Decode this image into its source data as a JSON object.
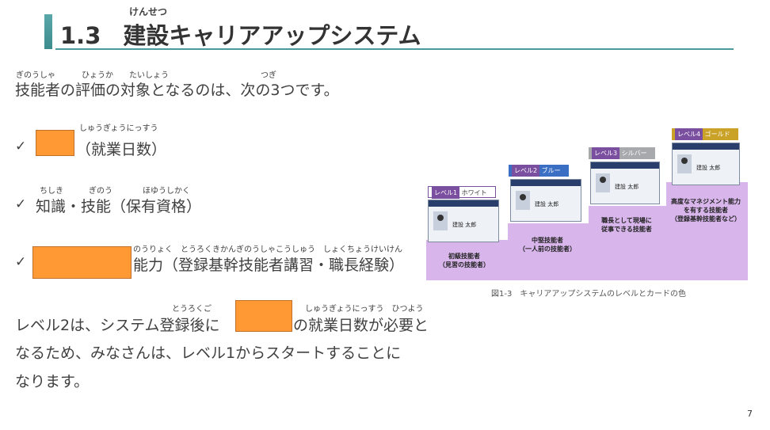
{
  "title": {
    "number": "1.3",
    "text": "建設キャリアアップシステム",
    "ruby": "けんせつ"
  },
  "intro": {
    "text": "技能者の評価の対象となるのは、次の3つです。",
    "ruby": [
      "ぎのうしゃ",
      "ひょうか",
      "たいしょう",
      "つぎ"
    ]
  },
  "items": [
    {
      "check": "✓",
      "text": "（就業日数）",
      "ruby": "しゅうぎょうにっすう"
    },
    {
      "check": "✓",
      "text": "知識・技能（保有資格）",
      "ruby": [
        "ちしき",
        "ぎのう",
        "ほゆうしかく"
      ]
    },
    {
      "check": "✓",
      "text": "能力（登録基幹技能者講習・職長経験）",
      "ruby": "のうりょく　とうろくきかんぎのうしゃこうしゅう　しょくちょうけいけん"
    }
  ],
  "paragraph": {
    "line1a": "レベル2は、システム登録後に",
    "line1b": "の就業日数が必要と",
    "line2": "なるため、みなさんは、レベル1からスタートすることに",
    "line3": "なります。",
    "ruby1": "とうろくご",
    "ruby2": "しゅうぎょうにっすう　ひつよう"
  },
  "figure": {
    "card_system": "建設キャリアアップシステム",
    "card_name": "建設 太郎",
    "levels": [
      {
        "badge": "レベル1",
        "color_name": "ホワイト",
        "role": "初級技能者",
        "sub": "（見習の技能者）",
        "color": "#ffffff",
        "lv_bg": "#7b4fa0"
      },
      {
        "badge": "レベル2",
        "color_name": "ブルー",
        "role": "中堅技能者",
        "sub": "（一人前の技能者）",
        "color": "#3b6fc4",
        "lv_bg": "#7b4fa0"
      },
      {
        "badge": "レベル3",
        "color_name": "シルバー",
        "role": "職長として現場に",
        "sub": "従事できる技能者",
        "color": "#a7a9ac",
        "lv_bg": "#7b4fa0"
      },
      {
        "badge": "レベル4",
        "color_name": "ゴールド",
        "role": "高度なマネジメント能力",
        "sub": "を有する技能者",
        "sub2": "（登録基幹技能者など）",
        "color": "#c9a227",
        "lv_bg": "#7b4fa0"
      }
    ],
    "caption": "図1-3　キャリアアップシステムのレベルとカードの色"
  },
  "page_number": "7",
  "colors": {
    "accent": "#4a9a9b",
    "blank_box": "#ff9933",
    "step": "#d8b6ec"
  }
}
